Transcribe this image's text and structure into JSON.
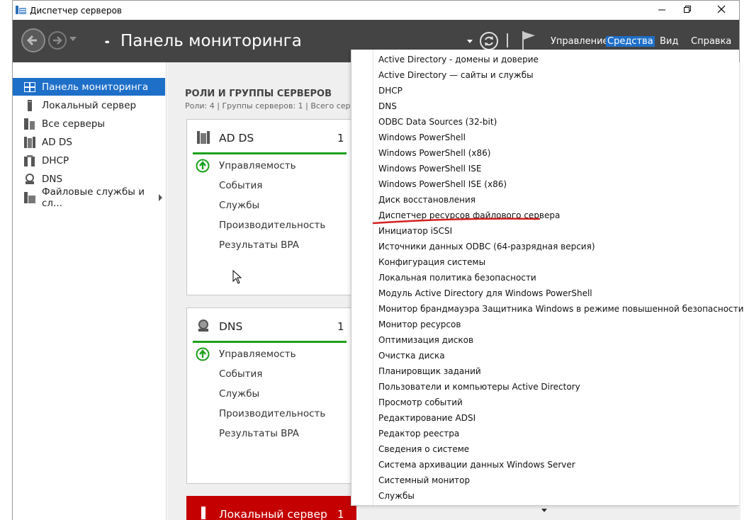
{
  "window": {
    "title": "Диспетчер серверов",
    "minimize_icon": "minimize-icon",
    "maximize_icon": "restore-icon",
    "close_icon": "close-icon"
  },
  "header": {
    "breadcrumb_prefix": "••",
    "title": "Панель мониторинга",
    "menus": [
      {
        "label": "Управление"
      },
      {
        "label": "Средства"
      },
      {
        "label": "Вид"
      },
      {
        "label": "Справка"
      }
    ],
    "active_menu": "Средства",
    "colors": {
      "header_bg": "#444444",
      "accent": "#1e6fc8"
    }
  },
  "sidebar": {
    "items": [
      {
        "label": "Панель мониторинга",
        "icon": "dashboard-icon",
        "active": true
      },
      {
        "label": "Локальный сервер",
        "icon": "server-icon",
        "active": false
      },
      {
        "label": "Все серверы",
        "icon": "servers-icon",
        "active": false
      },
      {
        "label": "AD DS",
        "icon": "adds-icon",
        "active": false
      },
      {
        "label": "DHCP",
        "icon": "dhcp-icon",
        "active": false
      },
      {
        "label": "DNS",
        "icon": "dns-icon",
        "active": false
      },
      {
        "label": "Файловые службы и сл...",
        "icon": "file-services-icon",
        "active": false
      }
    ]
  },
  "main": {
    "section_title": "РОЛИ И ГРУППЫ СЕРВЕРОВ",
    "section_subtitle": "Роли: 4 | Группы серверов: 1 | Всего серве",
    "tiles": [
      {
        "name": "AD DS",
        "count": "1",
        "rows": [
          "Управляемость",
          "События",
          "Службы",
          "Производительность",
          "Результаты BPA"
        ]
      },
      {
        "name": "DNS",
        "count": "1",
        "rows": [
          "Управляемость",
          "События",
          "Службы",
          "Производительность",
          "Результаты BPA"
        ]
      },
      {
        "name": "Локальный сервер",
        "count": "1",
        "status_color": "#c40000"
      }
    ]
  },
  "tools_menu": {
    "items": [
      "Active Directory - домены и доверие",
      "Active Directory — сайты и службы",
      "DHCP",
      "DNS",
      "ODBC Data Sources (32-bit)",
      "Windows PowerShell",
      "Windows PowerShell (x86)",
      "Windows PowerShell ISE",
      "Windows PowerShell ISE (x86)",
      "Диск восстановления",
      "Диспетчер ресурсов файлового сервера",
      "Инициатор iSCSI",
      "Источники данных ODBC (64-разрядная версия)",
      "Конфигурация системы",
      "Локальная политика безопасности",
      "Модуль Active Directory для Windows PowerShell",
      "Монитор брандмауэра Защитника Windows в режиме повышенной безопасности",
      "Монитор ресурсов",
      "Оптимизация дисков",
      "Очистка диска",
      "Планировщик заданий",
      "Пользователи и компьютеры Active Directory",
      "Просмотр событий",
      "Редактирование ADSI",
      "Редактор реестра",
      "Сведения о системе",
      "Система архивации данных Windows Server",
      "Системный монитор",
      "Службы"
    ],
    "highlighted_item": "Диспетчер ресурсов файлового сервера",
    "annotation_color": "#d42020"
  }
}
